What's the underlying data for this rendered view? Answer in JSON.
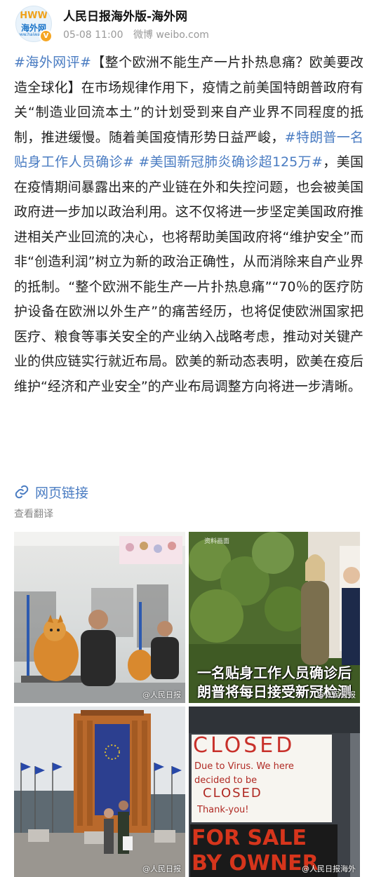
{
  "header": {
    "avatar_logo_top": "HWW",
    "avatar_logo_mid": "海外网",
    "avatar_logo_sub": "www.haiwainet.cn",
    "verified_badge": "V",
    "account_name": "人民日报海外版-海外网",
    "timestamp": "05-08 11:00",
    "source": "微博 weibo.com"
  },
  "post": {
    "tag1": "#海外网评#",
    "text1": "【整个欧洲不能生产一片扑热息痛？欧美要改造全球化】在市场规律作用下，疫情之前美国特朗普政府有关“制造业回流本土”的计划受到来自产业界不同程度的抵制，推进缓慢。随着美国疫情形势日益严峻，",
    "tag2": "#特朗普一名贴身工作人员确诊#",
    "text2": " ",
    "tag3": "#美国新冠肺炎确诊超125万#",
    "text3": "，美国在疫情期间暴露出来的产业链在外和失控问题，也会被美国政府进一步加以政治利用。这不仅将进一步坚定美国政府推进相关产业回流的决心，也将帮助美国政府将“维护安全”而非“创造利润”树立为新的政治正确性，从而消除来自产业界的抵制。“整个欧洲不能生产一片扑热息痛”“70％的医疗防护设备在欧洲以外生产”的痛苦经历，也将促使欧洲国家把医疗、粮食等事关安全的产业纳入战略考虑，推动对关键产业的供应链实行就近布局。欧美的新动态表明，欧美在疫后维护“经济和产业安全”的产业布局调整方向将进一步清晰。"
  },
  "link_label": "网页链接",
  "translate_label": "查看翻译",
  "photos": {
    "p1_watermark": "@人民日报",
    "p2_label": "资料画面",
    "p2_caption1": "一名贴身工作人员确诊后",
    "p2_caption2": "朗普将每日接受新冠检测",
    "p2_watermark": "@人民日报",
    "p3_watermark": "@人民日报",
    "p4_sign_closed": "CLOSED",
    "p4_sign_line1": "Due to Virus. We here",
    "p4_sign_line2": "decided to be",
    "p4_sign_closed2": "CLOSED",
    "p4_sign_thanks": "Thank-you!",
    "p4_sale1": "FOR SALE",
    "p4_sale2": "BY OWNER",
    "p4_watermark": "@人民日报海外"
  },
  "colors": {
    "accent_link": "#4a7cc2",
    "meta_gray": "#999999"
  }
}
